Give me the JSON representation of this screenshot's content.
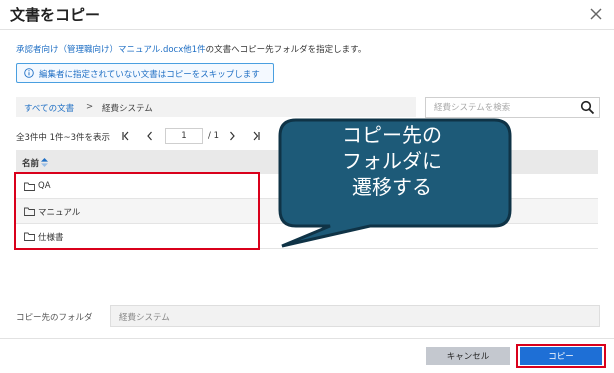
{
  "dialog": {
    "title": "文書をコピー",
    "description_link": "承認者向け（管理職向け）マニュアル.docx他1件",
    "description_rest": "の文書へコピー先フォルダを指定します。",
    "notice": "編集者に指定されていない文書はコピーをスキップします"
  },
  "breadcrumb": {
    "root": "すべての文書",
    "separator": ">",
    "current": "経費システム"
  },
  "search": {
    "placeholder": "経費システムを検索",
    "value": ""
  },
  "pager": {
    "summary": "全3件中 1件~3件を表示",
    "page": "1",
    "total": "/ 1"
  },
  "table": {
    "header_name": "名前",
    "rows": [
      {
        "label": "QA",
        "icon": "folder-icon"
      },
      {
        "label": "マニュアル",
        "icon": "folder-icon"
      },
      {
        "label": "仕様書",
        "icon": "folder-icon"
      }
    ]
  },
  "callout": {
    "text": "コピー先の\nフォルダに\n遷移する"
  },
  "destination": {
    "label": "コピー先のフォルダ",
    "value": "経費システム"
  },
  "buttons": {
    "cancel": "キャンセル",
    "copy": "コピー"
  },
  "colors": {
    "accent": "#1e6fd6",
    "link": "#1f6fc4",
    "highlight": "#d9001b",
    "callout_fill": "#1d5a78",
    "callout_stroke": "#0f3346"
  }
}
